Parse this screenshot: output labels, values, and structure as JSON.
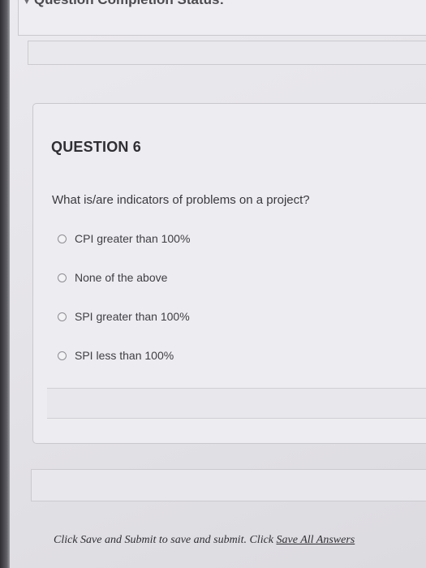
{
  "header": {
    "completion_status": "Question Completion Status:"
  },
  "question": {
    "heading": "QUESTION 6",
    "prompt": "What is/are indicators of problems on a project?",
    "options": [
      "CPI greater than 100%",
      "None of the above",
      "SPI greater than 100%",
      "SPI less than 100%"
    ],
    "selected_option": null
  },
  "footer": {
    "instruction_prefix": "Click Save and Submit to save and submit. Click ",
    "save_all_label": "Save All Answers"
  },
  "icons": {
    "status_toggle": "chevron-down-icon",
    "option_selector": "radio-button-icon"
  }
}
